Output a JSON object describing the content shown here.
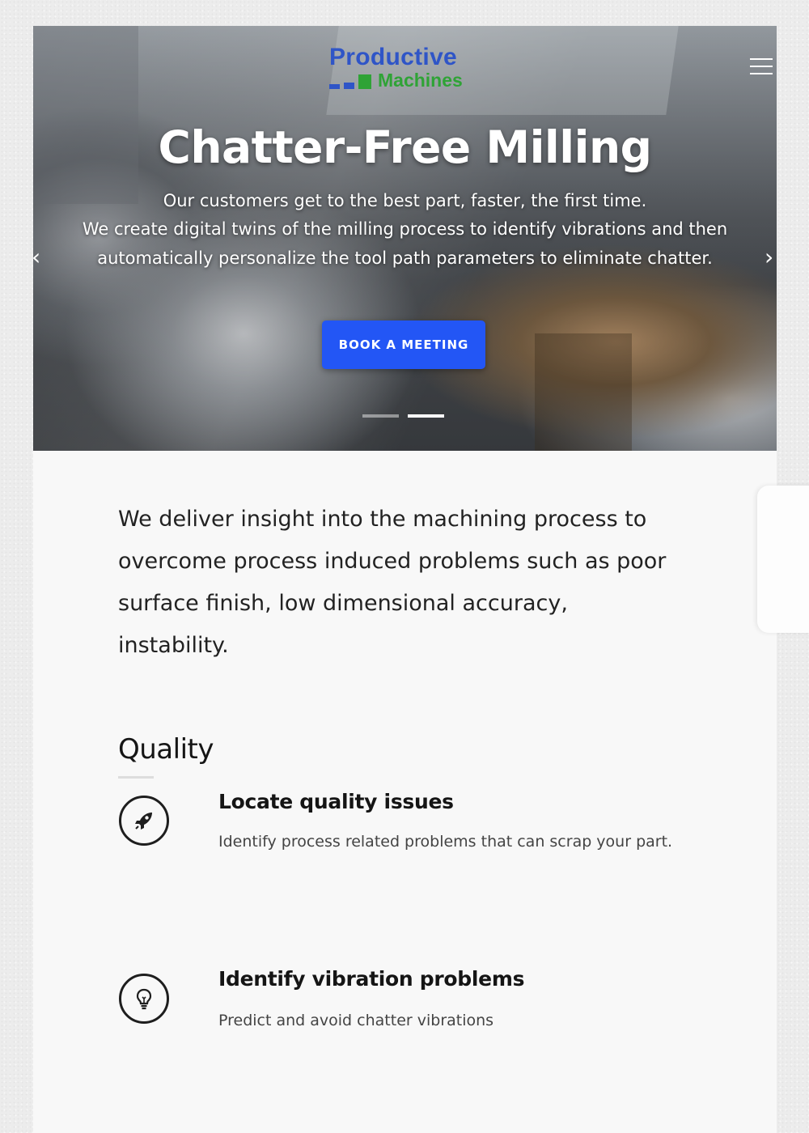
{
  "brand": {
    "line1": "Productive",
    "line2": "Machines",
    "colors": {
      "blue": "#2f55c7",
      "green": "#2fa336"
    }
  },
  "header": {
    "menu_icon": "hamburger-menu-icon"
  },
  "hero": {
    "title": "Chatter-Free Milling",
    "subtitle_lines": [
      "Our customers get to the best part, faster, the first time.",
      "We create digital twins of the milling process to identify vibrations and then",
      "automatically personalize the tool path parameters to eliminate chatter."
    ],
    "cta_label": "BOOK A MEETING",
    "cta_color": "#2356f5",
    "prev_icon": "chevron-left-icon",
    "next_icon": "chevron-right-icon",
    "slides_count": 2,
    "active_slide": 2
  },
  "intro": {
    "text": "We deliver insight into the machining process to overcome process induced problems such as poor surface finish, low dimensional accuracy, instability."
  },
  "quality": {
    "title": "Quality",
    "features": [
      {
        "icon": "rocket-icon",
        "title": "Locate quality issues",
        "description": "Identify process related problems that can scrap your part."
      },
      {
        "icon": "lightbulb-icon",
        "title": "Identify vibration problems",
        "description": "Predict and avoid chatter vibrations"
      }
    ]
  }
}
